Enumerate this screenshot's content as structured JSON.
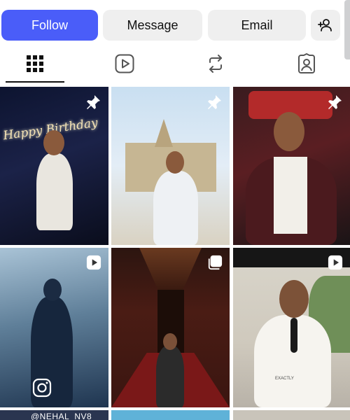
{
  "profile_actions": {
    "follow_label": "Follow",
    "message_label": "Message",
    "email_label": "Email",
    "add_user_icon": "person-add-icon"
  },
  "tabs": [
    {
      "icon": "grid-icon",
      "active": true
    },
    {
      "icon": "reels-icon",
      "active": false
    },
    {
      "icon": "reposts-icon",
      "active": false
    },
    {
      "icon": "tagged-icon",
      "active": false
    }
  ],
  "posts": [
    {
      "type": "image",
      "pinned": true,
      "overlay_text": "Happy Birthday"
    },
    {
      "type": "image",
      "pinned": true
    },
    {
      "type": "image",
      "pinned": true
    },
    {
      "type": "reel",
      "badge": "reels-icon"
    },
    {
      "type": "carousel",
      "badge": "carousel-icon"
    },
    {
      "type": "reel",
      "badge": "reels-icon",
      "overlay_text": "EXACTLY"
    },
    {
      "type": "image",
      "overlay_text": "@NEHAL_NV8"
    },
    {
      "type": "image"
    },
    {
      "type": "image"
    }
  ],
  "colors": {
    "follow_button": "#4a5df9",
    "secondary_button": "#efefef",
    "text": "#111111"
  }
}
